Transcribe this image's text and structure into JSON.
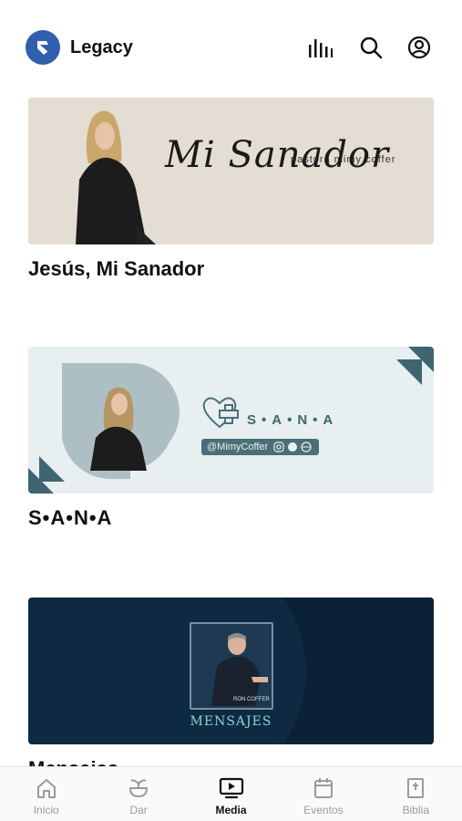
{
  "header": {
    "app_name": "Legacy",
    "icons": [
      "logo-icon",
      "audio-bars-icon",
      "search-icon",
      "account-icon"
    ]
  },
  "cards": [
    {
      "title": "Jesús, Mi Sanador",
      "banner_script": "Mi Sanador",
      "banner_sub": "pastora mimy coffer"
    },
    {
      "title": "S•A•N•A",
      "banner_title": "S•A•N•A",
      "banner_handle": "@MimyCoffer"
    },
    {
      "title": "Mensajes",
      "banner_title": "MENSAJES",
      "tile_caption": "RON COFFER"
    }
  ],
  "bottom_nav": {
    "items": [
      {
        "label": "Inicio",
        "icon": "home-icon"
      },
      {
        "label": "Dar",
        "icon": "plant-icon"
      },
      {
        "label": "Media",
        "icon": "media-icon",
        "active": true
      },
      {
        "label": "Eventos",
        "icon": "calendar-icon"
      },
      {
        "label": "Biblia",
        "icon": "bible-icon"
      }
    ]
  },
  "colors": {
    "accent": "#2f5fad",
    "active": "#111111",
    "inactive": "#9a9a9a"
  }
}
